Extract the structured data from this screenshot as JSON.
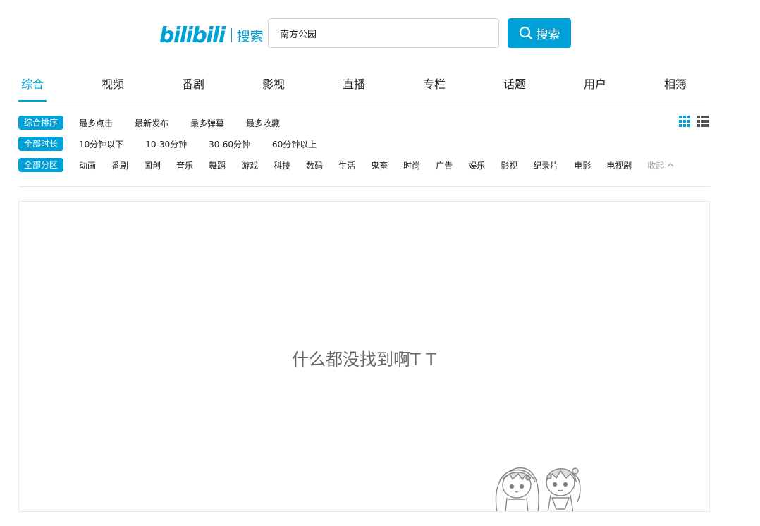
{
  "header": {
    "logo_text": "bilibili",
    "logo_sub": "搜索",
    "search_value": "南方公园",
    "search_button": "搜索"
  },
  "tabs": [
    {
      "label": "综合",
      "active": true
    },
    {
      "label": "视频"
    },
    {
      "label": "番剧"
    },
    {
      "label": "影视"
    },
    {
      "label": "直播"
    },
    {
      "label": "专栏"
    },
    {
      "label": "话题"
    },
    {
      "label": "用户"
    },
    {
      "label": "相簿"
    }
  ],
  "filters": {
    "order": {
      "label": "综合排序",
      "options": [
        "最多点击",
        "最新发布",
        "最多弹幕",
        "最多收藏"
      ]
    },
    "duration": {
      "label": "全部时长",
      "options": [
        "10分钟以下",
        "10-30分钟",
        "30-60分钟",
        "60分钟以上"
      ]
    },
    "zone": {
      "label": "全部分区",
      "options": [
        "动画",
        "番剧",
        "国创",
        "音乐",
        "舞蹈",
        "游戏",
        "科技",
        "数码",
        "生活",
        "鬼畜",
        "时尚",
        "广告",
        "娱乐",
        "影视",
        "纪录片",
        "电影",
        "电视剧"
      ],
      "collapse": "收起"
    }
  },
  "empty_message": "什么都没找到啊T T",
  "colors": {
    "accent": "#00a1d6",
    "border": "#e5e9ef"
  },
  "icons": [
    "search-icon",
    "grid-view-icon",
    "list-view-icon",
    "chevron-up-icon"
  ]
}
